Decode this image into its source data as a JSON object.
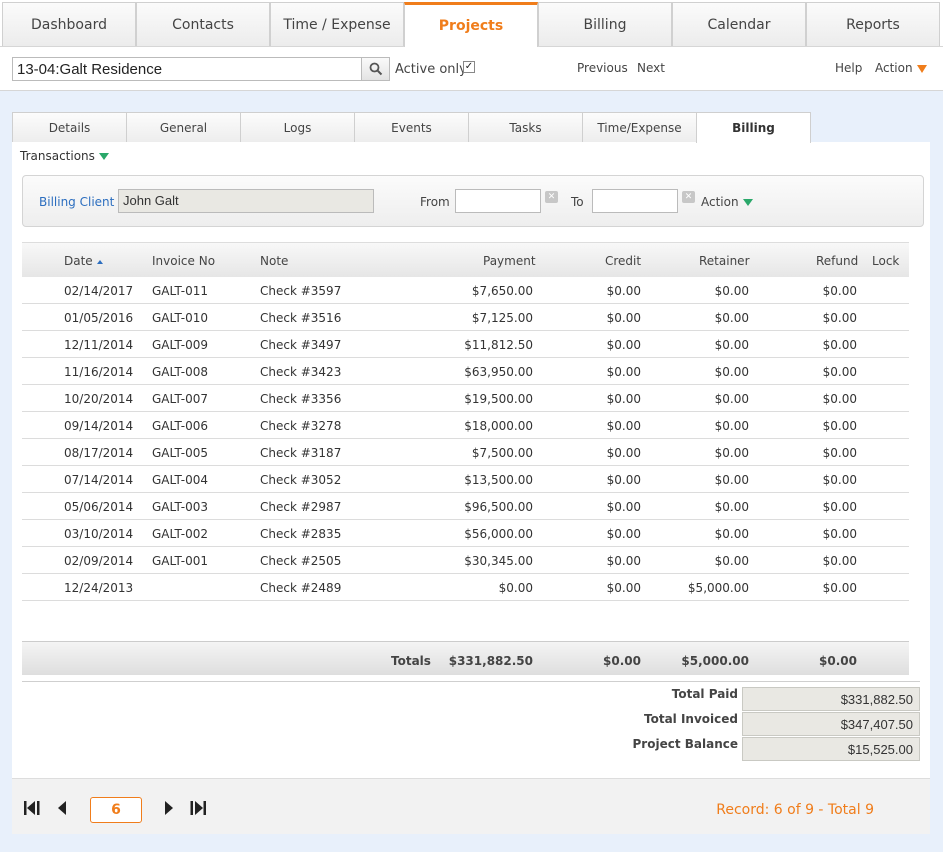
{
  "topnav": {
    "tabs": [
      {
        "label": "Dashboard"
      },
      {
        "label": "Contacts"
      },
      {
        "label": "Time / Expense"
      },
      {
        "label": "Projects"
      },
      {
        "label": "Billing"
      },
      {
        "label": "Calendar"
      },
      {
        "label": "Reports"
      }
    ],
    "active": "Projects",
    "accent_color": "#f07d1b"
  },
  "searchbar": {
    "value": "13-04:Galt Residence",
    "search_icon": "search-icon",
    "active_only_label": "Active only",
    "active_only_checked": true,
    "previous_label": "Previous",
    "next_label": "Next",
    "help_label": "Help",
    "action_label": "Action"
  },
  "subtabs": {
    "tabs": [
      {
        "label": "Details"
      },
      {
        "label": "General"
      },
      {
        "label": "Logs"
      },
      {
        "label": "Events"
      },
      {
        "label": "Tasks"
      },
      {
        "label": "Time/Expense"
      },
      {
        "label": "Billing"
      }
    ],
    "active": "Billing"
  },
  "section": {
    "label": "Transactions"
  },
  "filter": {
    "billing_client_label": "Billing Client",
    "billing_client_value": "John Galt",
    "from_label": "From",
    "from_value": "",
    "to_label": "To",
    "to_value": "",
    "action_label": "Action"
  },
  "table": {
    "columns": [
      "Date",
      "Invoice No",
      "Note",
      "Payment",
      "Credit",
      "Retainer",
      "Refund",
      "Lock"
    ],
    "sorted_by": "Date",
    "rows": [
      {
        "date": "02/14/2017",
        "invoice": "GALT-011",
        "note": "Check #3597",
        "payment": "$7,650.00",
        "credit": "$0.00",
        "retainer": "$0.00",
        "refund": "$0.00"
      },
      {
        "date": "01/05/2016",
        "invoice": "GALT-010",
        "note": "Check #3516",
        "payment": "$7,125.00",
        "credit": "$0.00",
        "retainer": "$0.00",
        "refund": "$0.00"
      },
      {
        "date": "12/11/2014",
        "invoice": "GALT-009",
        "note": "Check #3497",
        "payment": "$11,812.50",
        "credit": "$0.00",
        "retainer": "$0.00",
        "refund": "$0.00"
      },
      {
        "date": "11/16/2014",
        "invoice": "GALT-008",
        "note": "Check #3423",
        "payment": "$63,950.00",
        "credit": "$0.00",
        "retainer": "$0.00",
        "refund": "$0.00"
      },
      {
        "date": "10/20/2014",
        "invoice": "GALT-007",
        "note": "Check #3356",
        "payment": "$19,500.00",
        "credit": "$0.00",
        "retainer": "$0.00",
        "refund": "$0.00"
      },
      {
        "date": "09/14/2014",
        "invoice": "GALT-006",
        "note": "Check #3278",
        "payment": "$18,000.00",
        "credit": "$0.00",
        "retainer": "$0.00",
        "refund": "$0.00"
      },
      {
        "date": "08/17/2014",
        "invoice": "GALT-005",
        "note": "Check #3187",
        "payment": "$7,500.00",
        "credit": "$0.00",
        "retainer": "$0.00",
        "refund": "$0.00"
      },
      {
        "date": "07/14/2014",
        "invoice": "GALT-004",
        "note": "Check #3052",
        "payment": "$13,500.00",
        "credit": "$0.00",
        "retainer": "$0.00",
        "refund": "$0.00"
      },
      {
        "date": "05/06/2014",
        "invoice": "GALT-003",
        "note": "Check #2987",
        "payment": "$96,500.00",
        "credit": "$0.00",
        "retainer": "$0.00",
        "refund": "$0.00"
      },
      {
        "date": "03/10/2014",
        "invoice": "GALT-002",
        "note": "Check #2835",
        "payment": "$56,000.00",
        "credit": "$0.00",
        "retainer": "$0.00",
        "refund": "$0.00"
      },
      {
        "date": "02/09/2014",
        "invoice": "GALT-001",
        "note": "Check #2505",
        "payment": "$30,345.00",
        "credit": "$0.00",
        "retainer": "$0.00",
        "refund": "$0.00"
      },
      {
        "date": "12/24/2013",
        "invoice": "",
        "note": "Check #2489",
        "payment": "$0.00",
        "credit": "$0.00",
        "retainer": "$5,000.00",
        "refund": "$0.00"
      }
    ],
    "totals": {
      "label": "Totals",
      "payment": "$331,882.50",
      "credit": "$0.00",
      "retainer": "$5,000.00",
      "refund": "$0.00"
    }
  },
  "summary": {
    "total_paid_label": "Total Paid",
    "total_paid": "$331,882.50",
    "total_invoiced_label": "Total Invoiced",
    "total_invoiced": "$347,407.50",
    "project_balance_label": "Project Balance",
    "project_balance": "$15,525.00"
  },
  "pager": {
    "current_page": "6",
    "record_text": "Record: 6 of 9 - Total 9"
  }
}
